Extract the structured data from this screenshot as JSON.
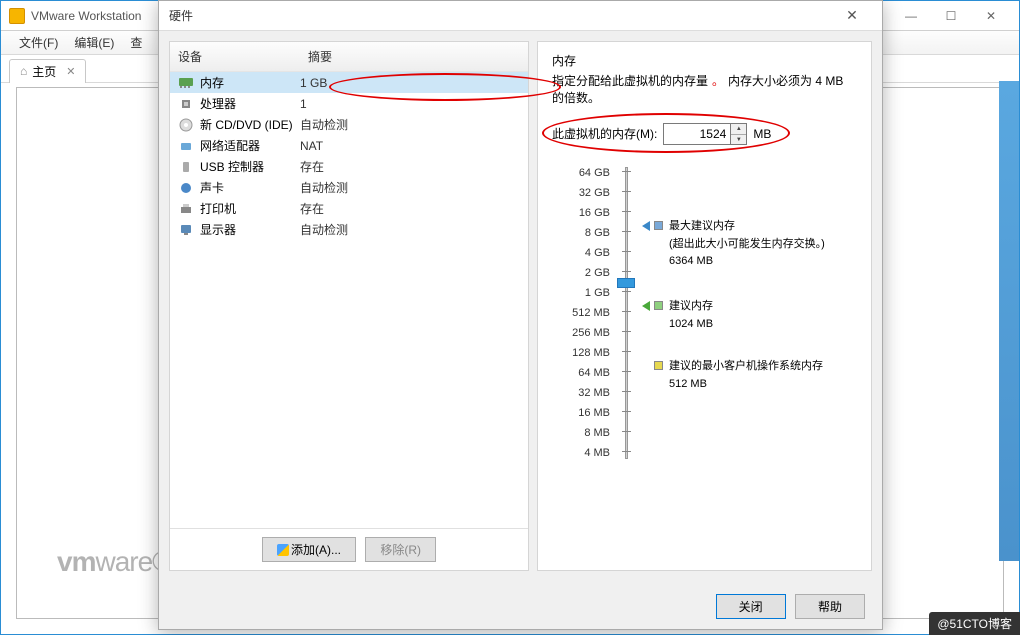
{
  "main_window": {
    "title": "VMware Workstation",
    "menus": [
      "文件(F)",
      "编辑(E)",
      "查"
    ],
    "tab_home": "主页",
    "logo_prefix": "vm",
    "logo_suffix": "ware"
  },
  "dialog": {
    "title": "硬件",
    "close_icon": "✕",
    "hardware_header": {
      "device": "设备",
      "summary": "摘要"
    },
    "hardware": [
      {
        "icon": "memory",
        "name": "内存",
        "summary": "1 GB",
        "selected": true
      },
      {
        "icon": "cpu",
        "name": "处理器",
        "summary": "1"
      },
      {
        "icon": "cd",
        "name": "新 CD/DVD (IDE)",
        "summary": "自动检测"
      },
      {
        "icon": "net",
        "name": "网络适配器",
        "summary": "NAT"
      },
      {
        "icon": "usb",
        "name": "USB 控制器",
        "summary": "存在"
      },
      {
        "icon": "sound",
        "name": "声卡",
        "summary": "自动检测"
      },
      {
        "icon": "printer",
        "name": "打印机",
        "summary": "存在"
      },
      {
        "icon": "display",
        "name": "显示器",
        "summary": "自动检测"
      }
    ],
    "add_button": "添加(A)...",
    "remove_button": "移除(R)",
    "close_button": "关闭",
    "help_button": "帮助"
  },
  "memory_panel": {
    "heading": "内存",
    "desc_prefix": "指定分配给此虚拟机的内存量",
    "desc_bullet": "。",
    "desc_suffix": "内存大小必须为 4 MB 的倍数。",
    "input_label": "此虚拟机的内存(M):",
    "input_value": "1524",
    "unit": "MB",
    "slider_ticks": [
      "64 GB",
      "32 GB",
      "16 GB",
      "8 GB",
      "4 GB",
      "2 GB",
      "1 GB",
      "512 MB",
      "256 MB",
      "128 MB",
      "64 MB",
      "32 MB",
      "16 MB",
      "8 MB",
      "4 MB"
    ],
    "max_rec": {
      "title": "最大建议内存",
      "note": "(超出此大小可能发生内存交换。)",
      "value": "6364 MB"
    },
    "rec": {
      "title": "建议内存",
      "value": "1024 MB"
    },
    "min_rec": {
      "title": "建议的最小客户机操作系统内存",
      "value": "512 MB"
    }
  },
  "watermark": "@51CTO博客"
}
